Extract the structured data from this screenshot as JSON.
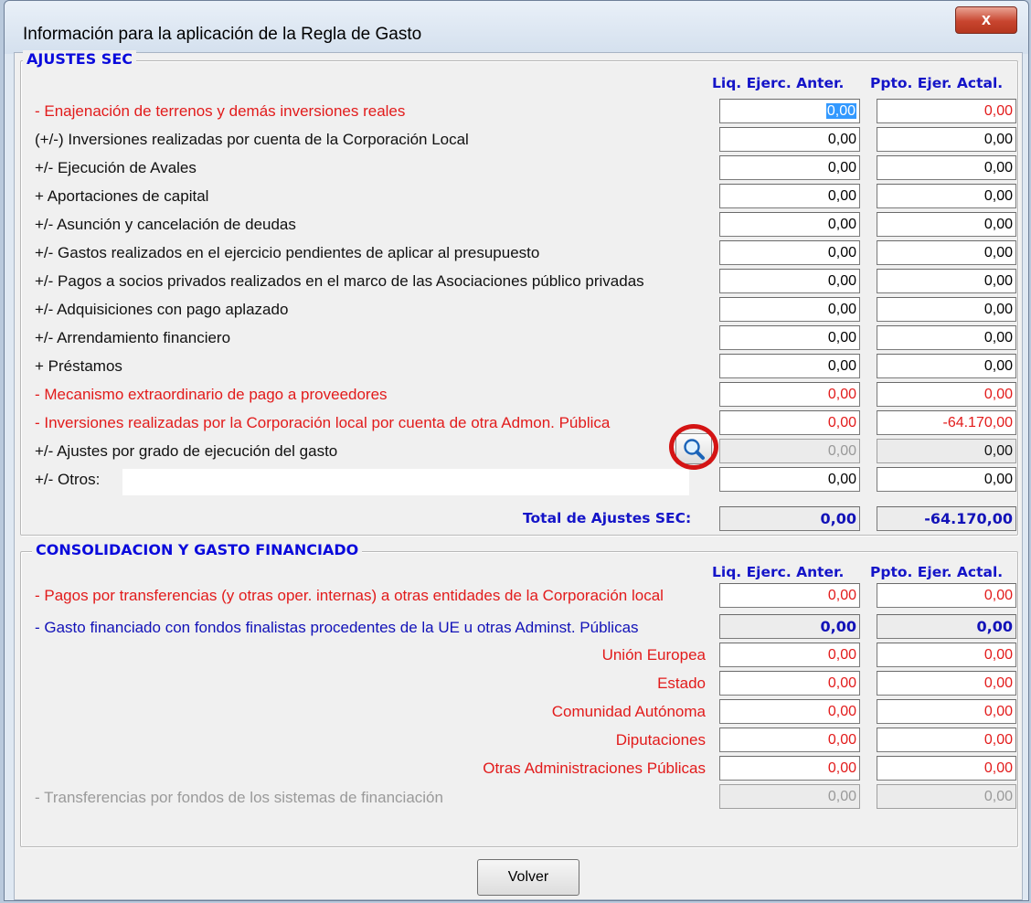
{
  "window": {
    "title": "Información para la aplicación de la Regla de Gasto",
    "close_glyph": "x"
  },
  "ajustes": {
    "title": "AJUSTES SEC",
    "col1": "Liq. Ejerc. Anter.",
    "col2": "Ppto. Ejer. Actal.",
    "rows": [
      {
        "label": "- Enajenación de terrenos y demás inversiones reales",
        "v1": "0,00",
        "v2": "0,00"
      },
      {
        "label": "(+/-) Inversiones realizadas por cuenta de la Corporación Local",
        "v1": "0,00",
        "v2": "0,00"
      },
      {
        "label": "+/- Ejecución de Avales",
        "v1": "0,00",
        "v2": "0,00"
      },
      {
        "label": "+ Aportaciones de capital",
        "v1": "0,00",
        "v2": "0,00"
      },
      {
        "label": "+/- Asunción y cancelación de deudas",
        "v1": "0,00",
        "v2": "0,00"
      },
      {
        "label": "+/- Gastos realizados en el ejercicio pendientes de aplicar al presupuesto",
        "v1": "0,00",
        "v2": "0,00"
      },
      {
        "label": "+/- Pagos a socios privados realizados en el marco de las Asociaciones público privadas",
        "v1": "0,00",
        "v2": "0,00"
      },
      {
        "label": "+/- Adquisiciones con pago aplazado",
        "v1": "0,00",
        "v2": "0,00"
      },
      {
        "label": "+/- Arrendamiento financiero",
        "v1": "0,00",
        "v2": "0,00"
      },
      {
        "label": "+ Préstamos",
        "v1": "0,00",
        "v2": "0,00"
      },
      {
        "label": "- Mecanismo extraordinario de pago a proveedores",
        "v1": "0,00",
        "v2": "0,00"
      },
      {
        "label": "- Inversiones realizadas por la Corporación local por cuenta de otra Admon. Pública",
        "v1": "0,00",
        "v2": "-64.170,00"
      },
      {
        "label": "+/- Ajustes por grado de ejecución del gasto",
        "v1": "0,00",
        "v2": "0,00"
      },
      {
        "label": "+/- Otros:",
        "v1": "0,00",
        "v2": "0,00"
      }
    ],
    "total_label": "Total de Ajustes SEC:",
    "total_v1": "0,00",
    "total_v2": "-64.170,00"
  },
  "consolidacion": {
    "title": "CONSOLIDACION Y GASTO FINANCIADO",
    "col1": "Liq. Ejerc. Anter.",
    "col2": "Ppto. Ejer. Actal.",
    "pagos": {
      "label": "- Pagos por transferencias (y otras oper. internas) a otras entidades de la Corporación local",
      "v1": "0,00",
      "v2": "0,00"
    },
    "gasto": {
      "label": "- Gasto financiado con fondos finalistas procedentes de la UE u otras Adminst. Públicas",
      "v1": "0,00",
      "v2": "0,00"
    },
    "sub": [
      {
        "label": "Unión Europea",
        "v1": "0,00",
        "v2": "0,00"
      },
      {
        "label": "Estado",
        "v1": "0,00",
        "v2": "0,00"
      },
      {
        "label": "Comunidad Autónoma",
        "v1": "0,00",
        "v2": "0,00"
      },
      {
        "label": "Diputaciones",
        "v1": "0,00",
        "v2": "0,00"
      },
      {
        "label": "Otras Administraciones Públicas",
        "v1": "0,00",
        "v2": "0,00"
      }
    ],
    "transf": {
      "label": "- Transferencias por fondos de los sistemas de financiación",
      "v1": "0,00",
      "v2": "0,00"
    }
  },
  "buttons": {
    "volver": "Volver"
  },
  "icons": {
    "magnifier": "magnifier-icon"
  },
  "colors": {
    "red": "#e21b1b",
    "blue": "#1212b8",
    "gray": "#9a9a9a",
    "highlight": "#d41414"
  }
}
